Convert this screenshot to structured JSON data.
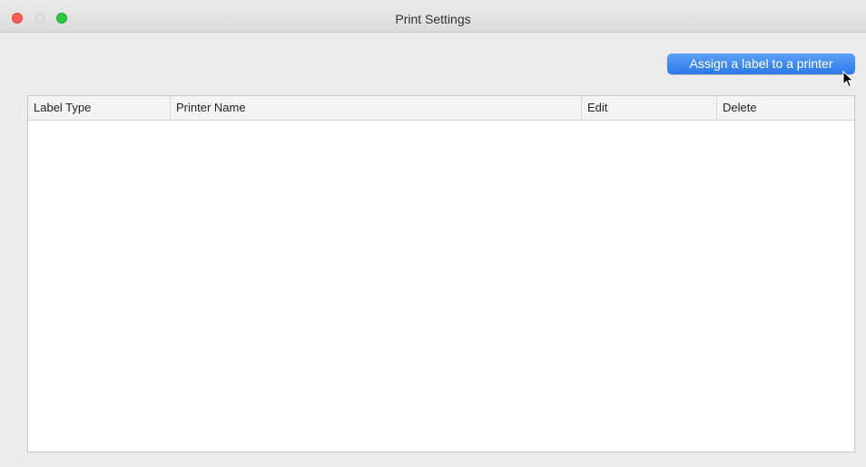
{
  "window": {
    "title": "Print Settings"
  },
  "toolbar": {
    "assign_label": "Assign a label to a printer"
  },
  "table": {
    "columns": [
      "Label Type",
      "Printer Name",
      "Edit",
      "Delete"
    ],
    "rows": []
  },
  "colors": {
    "accent": "#2b78e8",
    "close": "#fc5f57",
    "maximize": "#2ccb41"
  },
  "icons": {
    "cursor": "arrow-cursor-icon"
  }
}
